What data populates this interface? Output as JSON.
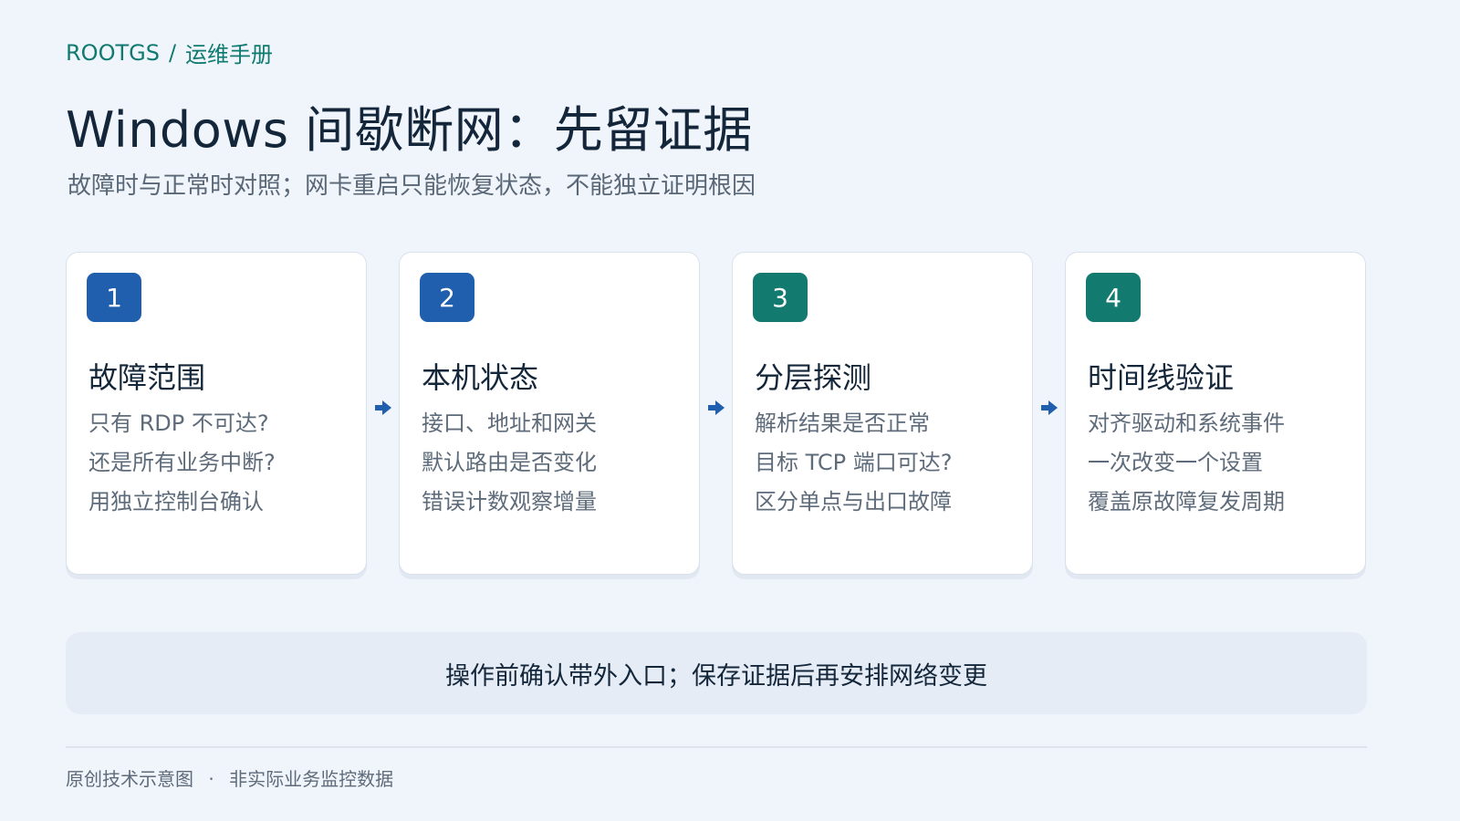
{
  "breadcrumb": {
    "brand": "ROOTGS",
    "separator": "/",
    "section": "运维手册"
  },
  "title": "Windows 间歇断网：先留证据",
  "subtitle": "故障时与正常时对照；网卡重启只能恢复状态，不能独立证明根因",
  "colors": {
    "blue": "#1f5fae",
    "teal": "#137a6f",
    "arrow": "#1f5fae"
  },
  "steps": [
    {
      "number": "1",
      "color": "blue",
      "title": "故障范围",
      "lines": [
        "只有 RDP 不可达?",
        "还是所有业务中断?",
        "用独立控制台确认"
      ]
    },
    {
      "number": "2",
      "color": "blue",
      "title": "本机状态",
      "lines": [
        "接口、地址和网关",
        "默认路由是否变化",
        "错误计数观察增量"
      ]
    },
    {
      "number": "3",
      "color": "teal",
      "title": "分层探测",
      "lines": [
        "解析结果是否正常",
        "目标 TCP 端口可达?",
        "区分单点与出口故障"
      ]
    },
    {
      "number": "4",
      "color": "teal",
      "title": "时间线验证",
      "lines": [
        "对齐驱动和系统事件",
        "一次改变一个设置",
        "覆盖原故障复发周期"
      ]
    }
  ],
  "arrow_icon": "arrow-right-icon",
  "callout": "操作前确认带外入口；保存证据后再安排网络变更",
  "footnote": {
    "left": "原创技术示意图",
    "separator": "·",
    "right": "非实际业务监控数据"
  }
}
